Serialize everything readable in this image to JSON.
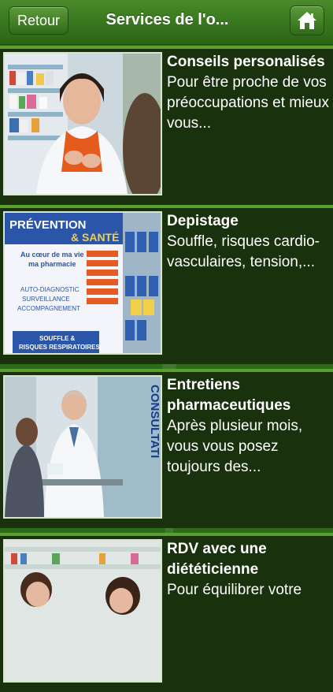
{
  "navbar": {
    "back_label": "Retour",
    "title": "Services de l'o...",
    "home_icon": "home-icon"
  },
  "services": [
    {
      "title": "Conseils personalisés",
      "description": "Pour être proche de vos préoccupations et mieux vous..."
    },
    {
      "title": "Depistage",
      "description": "Souffle, risques cardio-vasculaires, tension,..."
    },
    {
      "title": "Entretiens pharmaceutiques",
      "description": "Après plusieur mois, vous vous posez toujours des..."
    },
    {
      "title": "RDV avec une diététicienne",
      "description": "Pour équilibrer votre"
    }
  ],
  "images": {
    "poster_heading": "PRÉVENTION",
    "poster_heading2": "& SANTÉ",
    "poster_line1": "Au cœur de ma vie",
    "poster_line2": "ma pharmacie",
    "poster_item1": "AUTO-DIAGNOSTIC",
    "poster_item2": "SURVEILLANCE",
    "poster_item3": "ACCOMPAGNEMENT",
    "poster_footer1": "SOUFFLE &",
    "poster_footer2": "RISQUES RESPIRATOIRES",
    "consult_sign": "CONSULTATI"
  },
  "colors": {
    "navbar": "#3a7a1f",
    "background": "#2e6a1b",
    "cell": "#1a310e",
    "separator": "#5aa02e"
  }
}
